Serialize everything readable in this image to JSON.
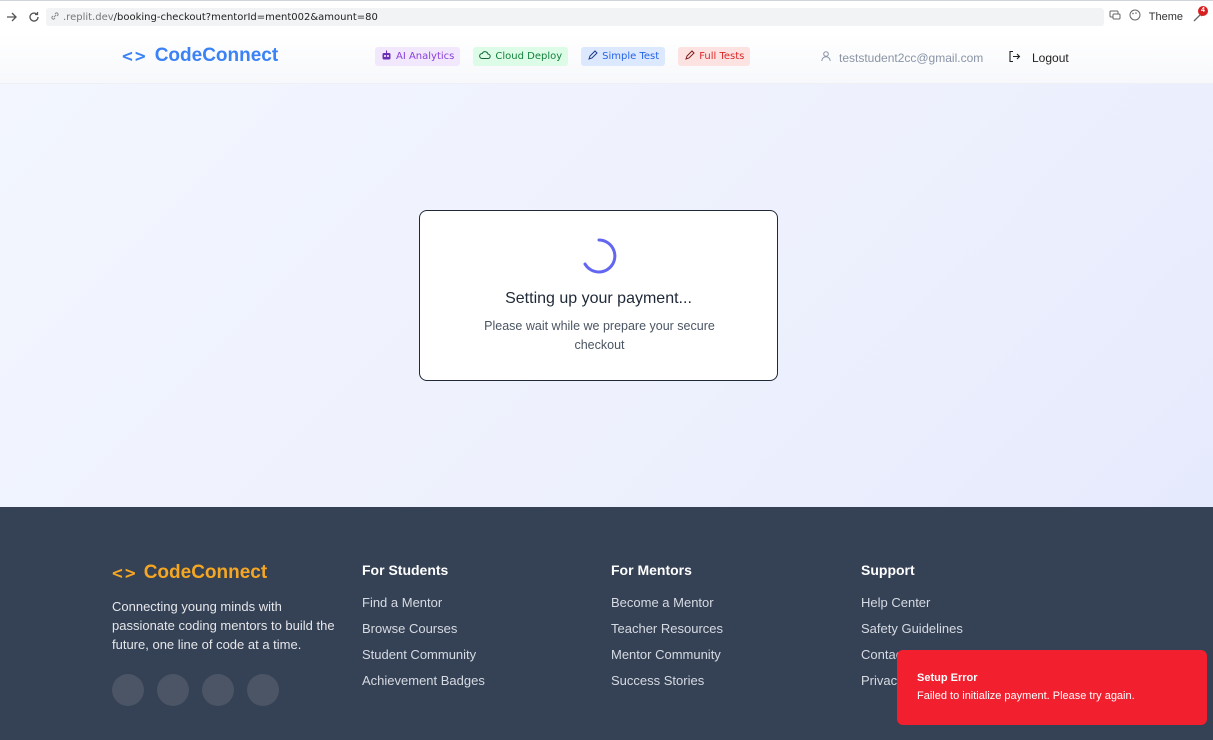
{
  "browser": {
    "url_prefix": ".replit.dev",
    "url_path": "/booking-checkout?mentorId=ment002&amount=80",
    "theme_label": "Theme",
    "notification_count": "4"
  },
  "header": {
    "logo_text": "CodeConnect",
    "chips": [
      {
        "label": "AI Analytics",
        "icon": "robot-icon"
      },
      {
        "label": "Cloud Deploy",
        "icon": "cloud-icon"
      },
      {
        "label": "Simple Test",
        "icon": "pencil-icon"
      },
      {
        "label": "Full Tests",
        "icon": "pencil-icon"
      }
    ],
    "user_email": "teststudent2cc@gmail.com",
    "logout_label": "Logout"
  },
  "main": {
    "card_title": "Setting up your payment...",
    "card_subtitle": "Please wait while we prepare your secure checkout"
  },
  "footer": {
    "logo_text": "CodeConnect",
    "description": "Connecting young minds with passionate coding mentors to build the future, one line of code at a time.",
    "columns": [
      {
        "title": "For Students",
        "links": [
          "Find a Mentor",
          "Browse Courses",
          "Student Community",
          "Achievement Badges"
        ]
      },
      {
        "title": "For Mentors",
        "links": [
          "Become a Mentor",
          "Teacher Resources",
          "Mentor Community",
          "Success Stories"
        ]
      },
      {
        "title": "Support",
        "links": [
          "Help Center",
          "Safety Guidelines",
          "Contact Us",
          "Privacy Policy"
        ]
      }
    ]
  },
  "toast": {
    "title": "Setup Error",
    "message": "Failed to initialize payment. Please try again."
  },
  "colors": {
    "brand_blue": "#3b82f6",
    "footer_logo": "#f5a623",
    "footer_bg": "#354154",
    "toast_bg": "#f21f2f"
  }
}
